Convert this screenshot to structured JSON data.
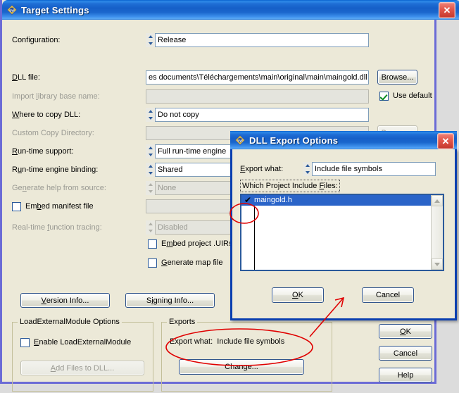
{
  "main_window": {
    "title": "Target Settings",
    "icon": "cvi-icon",
    "close_label": "✕",
    "fields": [
      {
        "label": "Configuration:",
        "underline": "",
        "value": "Release",
        "disabled": false,
        "spinner": true,
        "placeholder": ""
      },
      {
        "label": "DLL file:",
        "underline": "D",
        "value": "es documents\\Téléchargements\\main\\original\\main\\maingold.dll",
        "disabled": false,
        "spinner": false,
        "placeholder": ""
      },
      {
        "label": "Import library base name:",
        "underline": "l",
        "value": "",
        "disabled": true,
        "spinner": false,
        "placeholder": ""
      },
      {
        "label": "Where to copy DLL:",
        "underline": "W",
        "value": "Do not copy",
        "disabled": false,
        "spinner": true,
        "placeholder": ""
      },
      {
        "label": "Custom Copy Directory:",
        "underline": "",
        "value": "",
        "disabled": true,
        "spinner": false,
        "placeholder": ""
      },
      {
        "label": "Run-time support:",
        "underline": "R",
        "value": "Full run-time engine",
        "disabled": false,
        "spinner": true,
        "placeholder": ""
      },
      {
        "label": "Run-time engine binding:",
        "underline": "u",
        "value": "Shared",
        "disabled": false,
        "spinner": true,
        "placeholder": ""
      },
      {
        "label": "Generate help from source:",
        "underline": "n",
        "value": "None",
        "disabled": true,
        "spinner": true,
        "placeholder": ""
      },
      {
        "label": "Real-time function tracing:",
        "underline": "f",
        "value": "Disabled",
        "disabled": true,
        "spinner": true,
        "placeholder": ""
      }
    ],
    "browse_dll_label": "Browse...",
    "browse_custom_label": "Browse...",
    "use_default": {
      "label": "Use default",
      "checked": true
    },
    "embed_manifest": {
      "label": "Embed manifest file",
      "checked": false
    },
    "embed_uirs": {
      "label": "Embed project .UIRs",
      "checked": false
    },
    "generate_map": {
      "label": "Generate map file",
      "checked": false
    },
    "version_info_label": "Version Info...",
    "signing_info_label": "Signing Info...",
    "ok_label": "OK",
    "cancel_label": "Cancel",
    "help_label": "Help",
    "lem_group": {
      "caption": "LoadExternalModule Options",
      "enable_label": "Enable LoadExternalModule",
      "enable_checked": false,
      "add_files_label": "Add Files to DLL..."
    },
    "exports_group": {
      "caption": "Exports",
      "export_what_label": "Export what:",
      "export_what_value": "Include file symbols",
      "change_label": "Change..."
    }
  },
  "dll_dialog": {
    "title": "DLL Export Options",
    "icon": "cvi-icon",
    "close_label": "✕",
    "export_what_label": "Export what:",
    "export_what_value": "Include file symbols",
    "list_caption": "Which Project Include Files:",
    "list_items": [
      {
        "label": "maingold.h",
        "checked": true,
        "selected": true
      }
    ],
    "ok_label": "OK",
    "cancel_label": "Cancel"
  },
  "colors": {
    "face": "#ece9d8",
    "title_blue": "#1a66cc",
    "selection": "#2a64c8",
    "annotation_red": "#e00000",
    "main_border": "#6b6bd6",
    "dialog_border": "#0a3fb0",
    "desktop": "#dcdcdc"
  }
}
